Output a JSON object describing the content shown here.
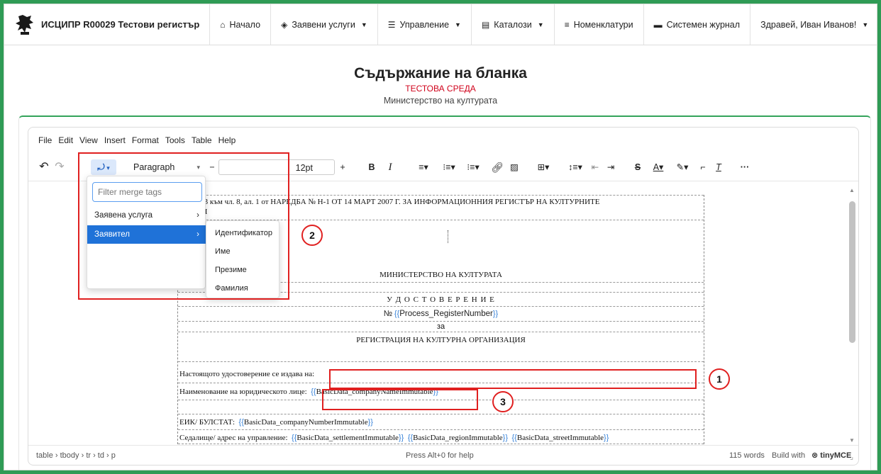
{
  "navbar": {
    "brand": "ИСЦИПР R00029 Тестови регистър",
    "items": [
      {
        "label": "Начало",
        "icon": "home-icon"
      },
      {
        "label": "Заявени услуги",
        "icon": "layers-icon"
      },
      {
        "label": "Управление",
        "icon": "sliders-icon"
      },
      {
        "label": "Каталози",
        "icon": "catalog-icon"
      },
      {
        "label": "Номенклатури",
        "icon": "list-icon"
      },
      {
        "label": "Системен журнал",
        "icon": "journal-icon"
      }
    ],
    "user": "Здравей, Иван Иванов!"
  },
  "header": {
    "title": "Съдържание на бланка",
    "environment": "ТЕСТОВА СРЕДА",
    "ministry": "Министерство на културата"
  },
  "editor": {
    "menu": [
      "File",
      "Edit",
      "View",
      "Insert",
      "Format",
      "Tools",
      "Table",
      "Help"
    ],
    "toolbar": {
      "block_format": "Paragraph",
      "font_size": "12pt"
    },
    "merge_tags": {
      "filter_placeholder": "Filter merge tags",
      "groups": [
        "Заявена услуга",
        "Заявител"
      ],
      "submenu": [
        "Идентификатор",
        "Име",
        "Презиме",
        "Фамилия"
      ]
    },
    "document": {
      "line1": "ние № 3 към чл. 8, ал. 1 от НАРЕДБА № Н-1 ОТ 14 МАРТ 2007 Г. ЗА ИНФОРМАЦИОННИЯ РЕГИСТЪР НА КУЛТУРНИТЕ",
      "line2": "ЗАЦИИ",
      "ministry": "МИНИСТЕРСТВО НА КУЛТУРАТА",
      "cert_title": "У Д О С Т О В Е Р Е Н И Е",
      "number_prefix": "№",
      "number_tag": "Process_RegisterNumber",
      "za": "за",
      "reg_title": "РЕГИСТРАЦИЯ НА КУЛТУРНА ОРГАНИЗАЦИЯ",
      "issued_to": "Настоящото удостоверение се издава на:",
      "legal_name_label": "Наименование на юридическото лице:",
      "legal_name_tag": "BasicData_companyNameImmutable",
      "eik_label": "ЕИК/ БУЛСТАТ:",
      "eik_tag": "BasicData_companyNumberImmutable",
      "address_label": "Седалище/ адрес на управление:",
      "address_tags": [
        "BasicData_settlementImmutable",
        "BasicData_regionImmutable",
        "BasicData_streetImmutable"
      ]
    },
    "status": {
      "path": "table › tbody › tr › td › p",
      "help": "Press Alt+0 for help",
      "words": "115 words",
      "build": "Build with",
      "brand": "tinyMCE"
    }
  },
  "annotations": [
    "1",
    "2",
    "3"
  ],
  "colors": {
    "accent": "#33a35a",
    "annotation": "#e02020",
    "tag": "#3a84d9",
    "env": "#d0021b"
  }
}
